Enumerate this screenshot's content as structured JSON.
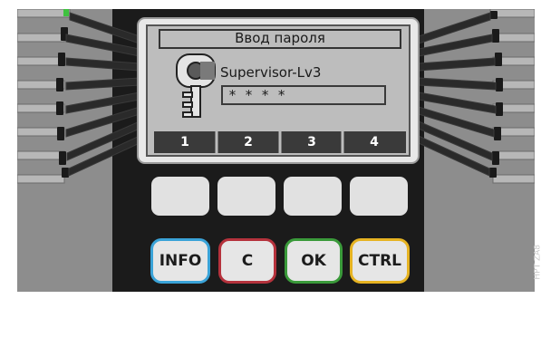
{
  "screen": {
    "title": "Ввод пароля",
    "user_level": "Supervisor-Lv3",
    "password_mask": "* * * *",
    "softkeys": [
      "1",
      "2",
      "3",
      "4"
    ]
  },
  "buttons": {
    "info": "INFO",
    "c": "C",
    "ok": "OK",
    "ctrl": "CTRL"
  },
  "colors": {
    "info_border": "#3aa3d8",
    "c_border": "#b5323c",
    "ok_border": "#3a9a3a",
    "ctrl_border": "#e6b322"
  },
  "icons": {
    "key": "key-icon"
  },
  "side_note": "HPT ZA8"
}
